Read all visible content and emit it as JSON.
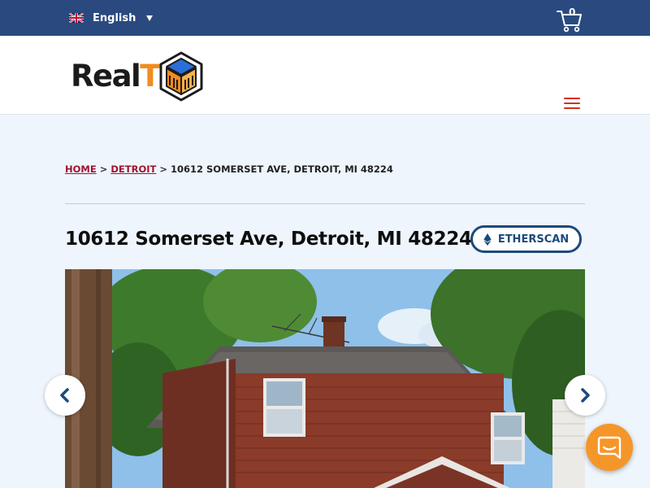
{
  "topbar": {
    "language": "English",
    "flag_icon": "uk-flag-icon",
    "cart_count": "0",
    "cart_icon": "shopping-cart-icon"
  },
  "header": {
    "logo_text": "Real",
    "logo_letter": "T",
    "logo_icon": "cube-building-icon",
    "menu_icon": "hamburger-menu-icon"
  },
  "breadcrumb": {
    "home": "HOME",
    "city": "DETROIT",
    "current": "10612 SOMERSET AVE, DETROIT, MI 48224",
    "separator": ">"
  },
  "property": {
    "title": "10612 Somerset Ave, Detroit, MI 48224",
    "etherscan_label": "ETHERSCAN",
    "etherscan_icon": "ethereum-icon"
  },
  "gallery": {
    "prev_icon": "chevron-left-icon",
    "next_icon": "chevron-right-icon"
  },
  "chat": {
    "icon": "chat-bubble-icon"
  },
  "colors": {
    "topbar": "#2a4a7f",
    "page_bg": "#eef5fc",
    "breadcrumb_link": "#a4122e",
    "accent_orange": "#f28c1d",
    "etherscan_blue": "#1c4a7c",
    "chat_orange": "#f5962a"
  }
}
